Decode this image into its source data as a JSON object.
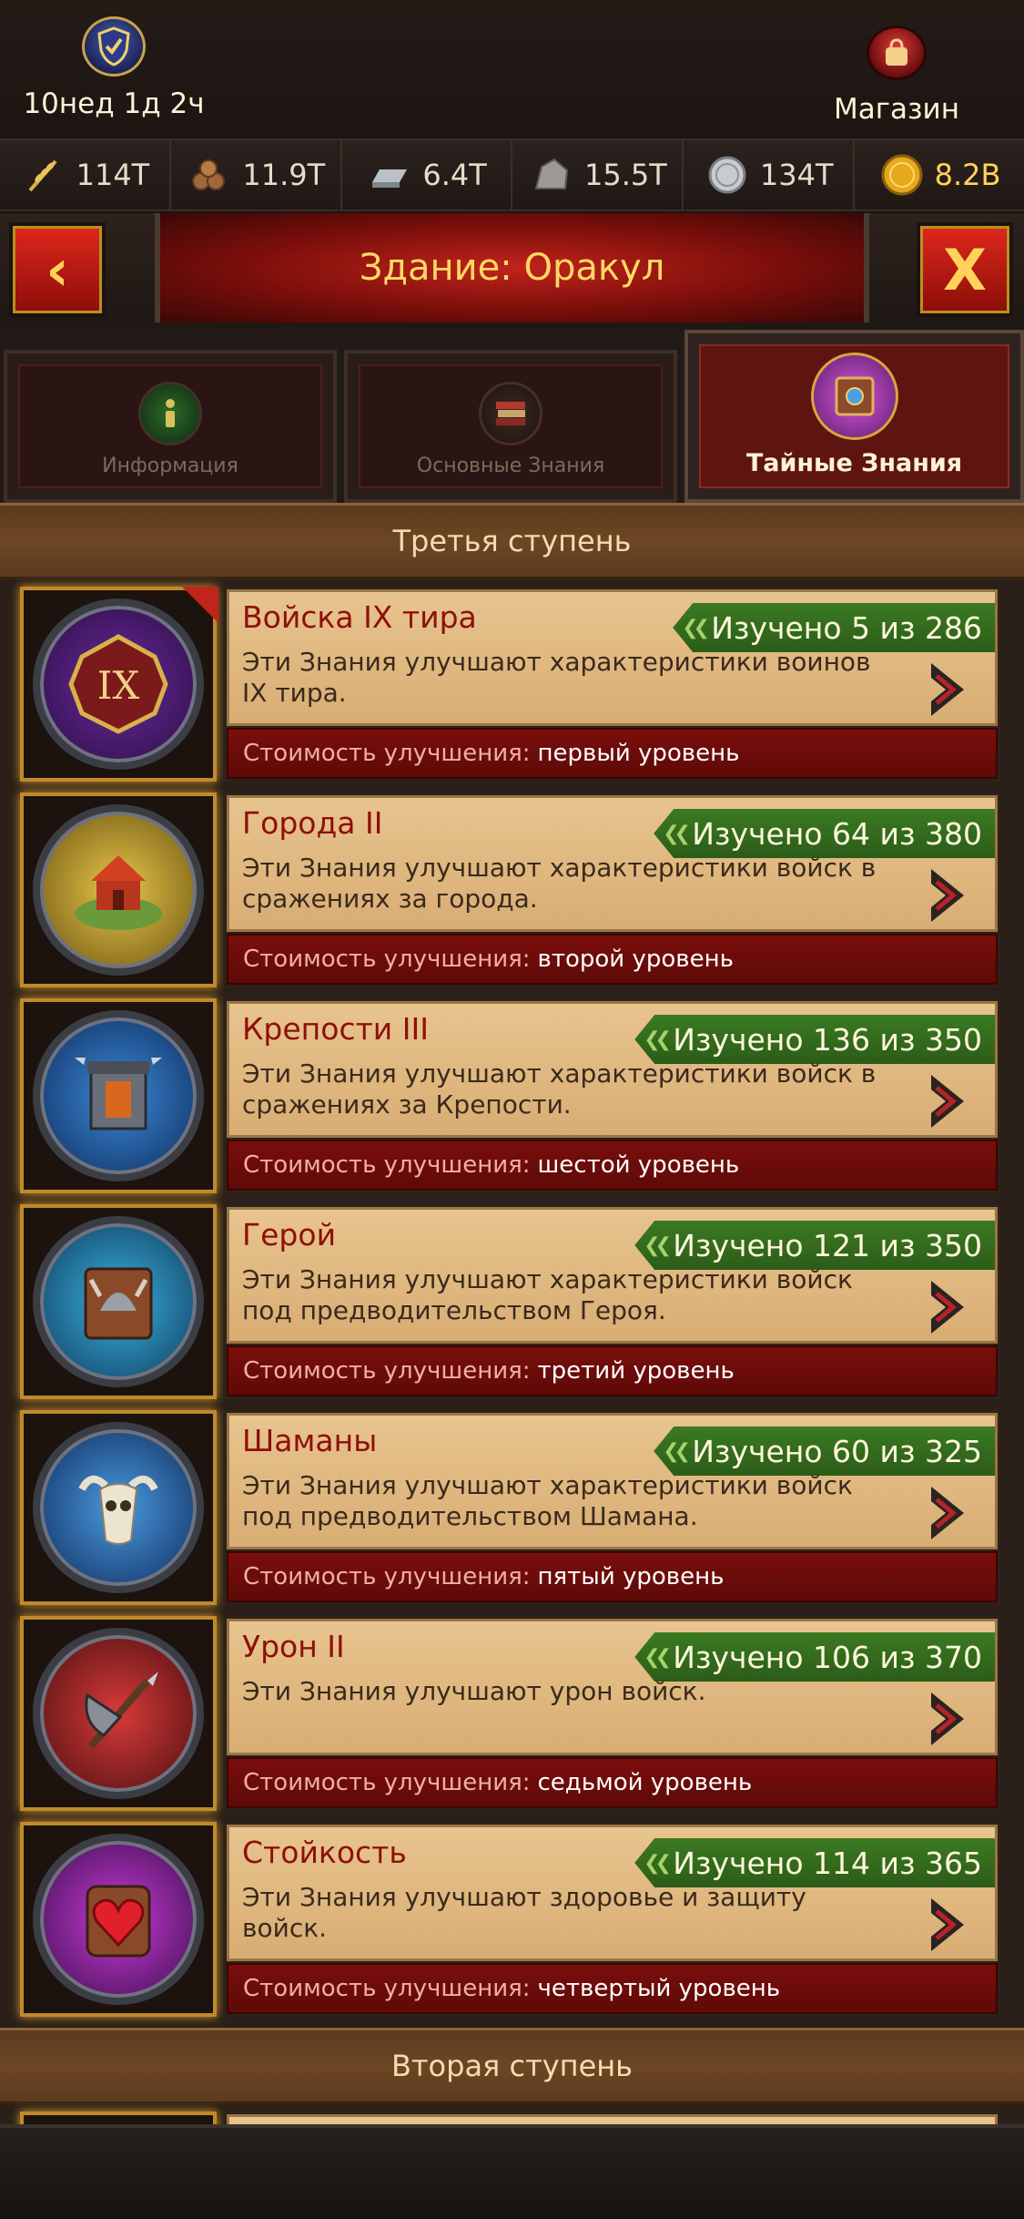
{
  "header": {
    "clan_timer": "10нед 1д 2ч",
    "shop_label": "Магазин"
  },
  "resources": [
    {
      "icon": "wheat-icon",
      "value": "114T"
    },
    {
      "icon": "wood-icon",
      "value": "11.9T"
    },
    {
      "icon": "iron-icon",
      "value": "6.4T"
    },
    {
      "icon": "stone-icon",
      "value": "15.5T"
    },
    {
      "icon": "silver-icon",
      "value": "134T"
    },
    {
      "icon": "gold-icon",
      "value": "8.2B"
    }
  ],
  "title": "Здание: Оракул",
  "tabs": [
    {
      "label": "Информация",
      "active": false
    },
    {
      "label": "Основные Знания",
      "active": false
    },
    {
      "label": "Тайные Знания",
      "active": true
    }
  ],
  "sections": [
    {
      "heading": "Третья ступень",
      "cost_label": "Стоимость улучшения:",
      "items": [
        {
          "title": "Войска IX тира",
          "progress": "Изучено 5 из 286",
          "desc": "Эти Знания улучшают характеристики воинов IX тира.",
          "cost": "первый уровень",
          "icon": "tier-ix-icon"
        },
        {
          "title": "Города II",
          "progress": "Изучено 64 из 380",
          "desc": "Эти Знания улучшают характеристики войск в сражениях за города.",
          "cost": "второй уровень",
          "icon": "city-icon"
        },
        {
          "title": "Крепости III",
          "progress": "Изучено 136 из 350",
          "desc": "Эти Знания улучшают характеристики войск в сражениях за Крепости.",
          "cost": "шестой уровень",
          "icon": "fortress-icon"
        },
        {
          "title": "Герой",
          "progress": "Изучено 121 из 350",
          "desc": "Эти Знания улучшают характеристики войск под предводительством Героя.",
          "cost": "третий уровень",
          "icon": "hero-book-icon"
        },
        {
          "title": "Шаманы",
          "progress": "Изучено 60 из 325",
          "desc": "Эти Знания улучшают характеристики войск под предводительством Шамана.",
          "cost": "пятый уровень",
          "icon": "shaman-skull-icon"
        },
        {
          "title": "Урон II",
          "progress": "Изучено 106 из 370",
          "desc": "Эти Знания улучшают урон войск.",
          "cost": "седьмой уровень",
          "icon": "damage-axe-icon"
        },
        {
          "title": "Стойкость",
          "progress": "Изучено 114 из 365",
          "desc": "Эти Знания улучшают здоровье и защиту войск.",
          "cost": "четвертый уровень",
          "icon": "heart-shield-icon"
        }
      ]
    },
    {
      "heading": "Вторая ступень"
    }
  ],
  "colors": {
    "accent_gold": "#ffd866",
    "title_red": "#8e0f0b",
    "badge_green": "#3b7a22",
    "cost_red": "#7a0e0c"
  }
}
